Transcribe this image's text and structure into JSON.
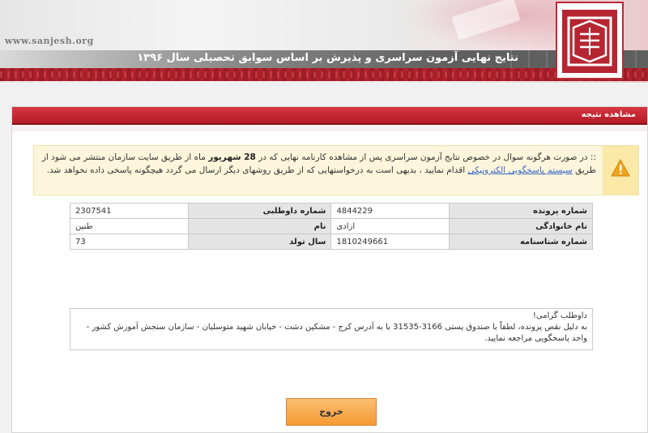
{
  "header": {
    "site_url": "www.sanjesh.org",
    "page_title": "نتایج نهایی آزمون سراسری و پذیرش بر اساس سوابق تحصیلی سال ۱۳۹۶",
    "colors": {
      "brand_red": "#b31c27",
      "band_gray": "#5f5f5f"
    },
    "logo_icon": "sanjesh-logo"
  },
  "panel": {
    "title": "مشاهده نتیجه"
  },
  "alert": {
    "icon": "warning-icon",
    "text_part1": ":: در صورت هرگونه سوال در خصوص نتایج آزمون سراسری پس از مشاهده کارنامه نهایی که در ",
    "text_bold": "28 شهریور",
    "text_part2": " ماه از طریق سایت سازمان منتشر می شود از طریق ",
    "link_text": "سیستم پاسخگویی الکترونیکی",
    "text_part3": " اقدام نمایید ، بدیهی است به درخواستهایی که از طریق روشهای دیگر ارسال می گردد هیچگونه پاسخی داده نخواهد شد."
  },
  "info_table": {
    "rows": [
      {
        "label1": "شماره پرونده",
        "value1": "4844229",
        "label2": "شماره داوطلبی",
        "value2": "2307541"
      },
      {
        "label1": "نام خانوادگی",
        "value1": "ازادی",
        "label2": "نام",
        "value2": "طنین"
      },
      {
        "label1": "شماره شناسنامه",
        "value1": "1810249661",
        "label2": "سال تولد",
        "value2": "73"
      }
    ]
  },
  "message": {
    "greeting": "داوطلب گرامی!",
    "body": "به دلیل نقص پرونده، لطفاً با صندوق پستی 3166-31535 با به آدرس کرج - مشکین دشت - خیابان شهید متوسلیان - سازمان سنجش آموزش کشور - واحد پاسخگویی مراجعه نمایید."
  },
  "exit_button": {
    "label": "خروج",
    "color": "#f59a33"
  }
}
